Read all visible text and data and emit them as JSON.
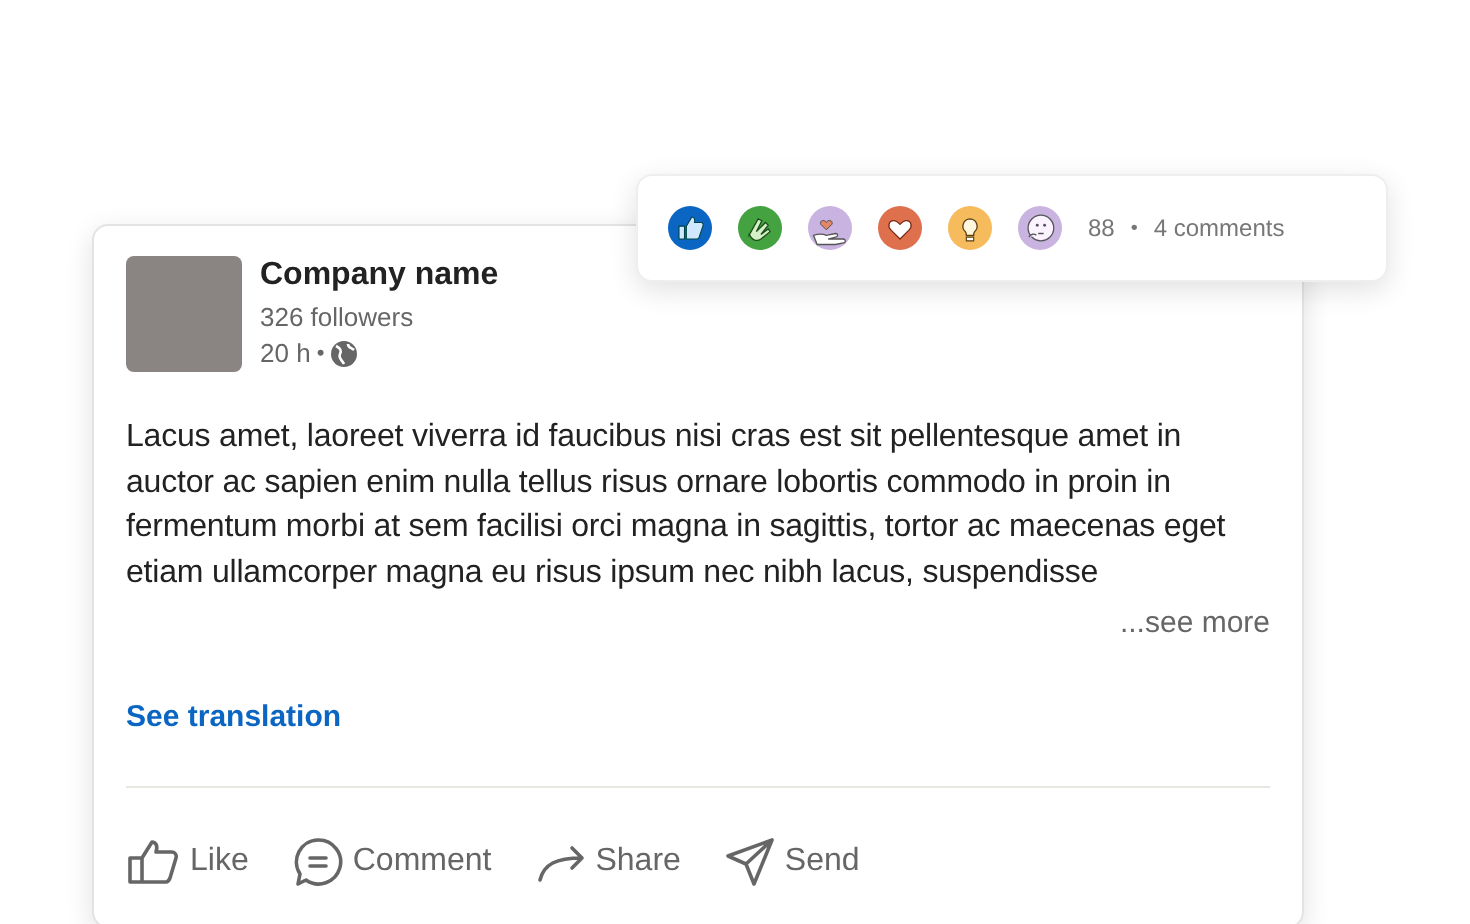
{
  "post": {
    "author": "Company name",
    "followers": "326 followers",
    "time": "20 h",
    "separator": "•",
    "body": "Lacus amet, laoreet viverra id faucibus nisi cras est sit pellentesque amet in auctor ac sapien enim nulla tellus risus ornare lobortis commodo in proin in fermentum morbi at sem facilisi orci magna in sagittis, tortor ac maecenas eget etiam ullamcorper magna eu risus ipsum nec nibh lacus, suspendisse",
    "see_more": "...see more",
    "translation_link": "See translation",
    "actions": [
      {
        "kind": "like",
        "label": "Like"
      },
      {
        "kind": "comment",
        "label": "Comment"
      },
      {
        "kind": "share",
        "label": "Share"
      },
      {
        "kind": "send",
        "label": "Send"
      }
    ]
  },
  "reactions_popup": {
    "reactions": [
      {
        "kind": "like"
      },
      {
        "kind": "celebrate"
      },
      {
        "kind": "support"
      },
      {
        "kind": "love"
      },
      {
        "kind": "insightful"
      },
      {
        "kind": "curious"
      }
    ],
    "count": "88",
    "separator": "•",
    "comments": "4 comments"
  }
}
